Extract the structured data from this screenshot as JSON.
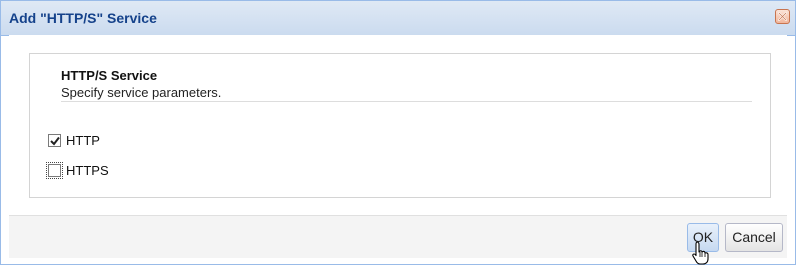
{
  "dialog": {
    "title": "Add \"HTTP/S\" Service",
    "close_icon": "close-icon"
  },
  "section": {
    "title": "HTTP/S Service",
    "description": "Specify service parameters."
  },
  "options": [
    {
      "label": "HTTP",
      "checked": true
    },
    {
      "label": "HTTPS",
      "checked": false
    }
  ],
  "buttons": {
    "ok_label": "OK",
    "cancel_label": "Cancel"
  },
  "colors": {
    "title_text": "#15428b",
    "border": "#99bbe8",
    "close_button": "#f1b69c"
  }
}
